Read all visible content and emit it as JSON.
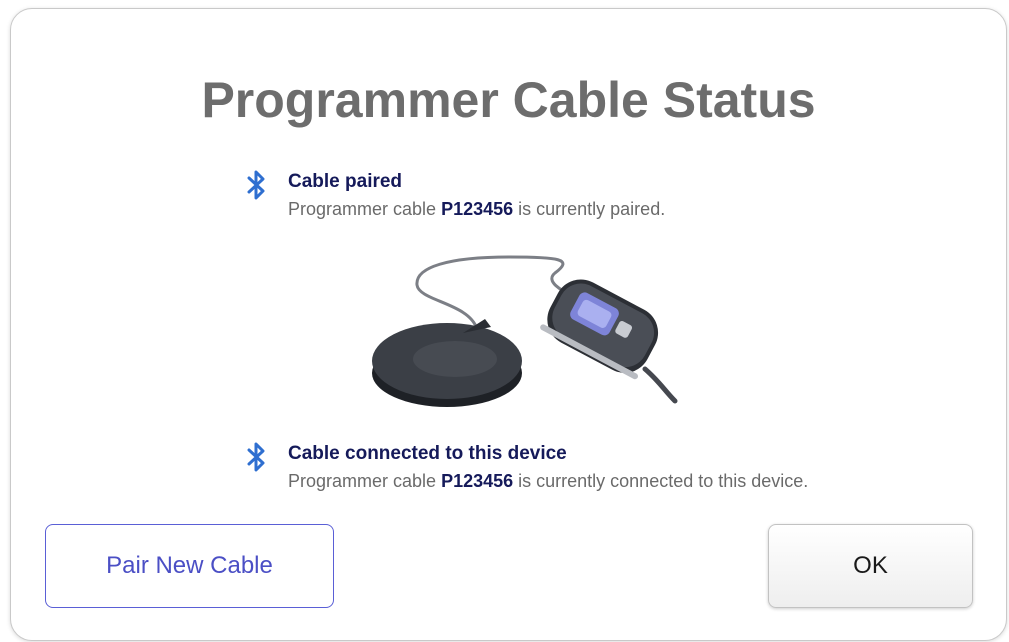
{
  "dialog": {
    "title": "Programmer Cable Status"
  },
  "status_items": [
    {
      "icon": "bluetooth-icon",
      "heading": "Cable paired",
      "desc_prefix": "Programmer cable ",
      "serial": "P123456",
      "desc_suffix": " is currently paired."
    },
    {
      "icon": "bluetooth-icon",
      "heading": "Cable connected to this device",
      "desc_prefix": "Programmer cable ",
      "serial": "P123456",
      "desc_suffix": " is currently connected to this device."
    }
  ],
  "buttons": {
    "pair_new_cable": "Pair New Cable",
    "ok": "OK"
  },
  "colors": {
    "title": "#6d6d6d",
    "heading": "#151a5a",
    "bluetooth": "#2f6fd0",
    "pair_button_border": "#5a5fd6"
  }
}
